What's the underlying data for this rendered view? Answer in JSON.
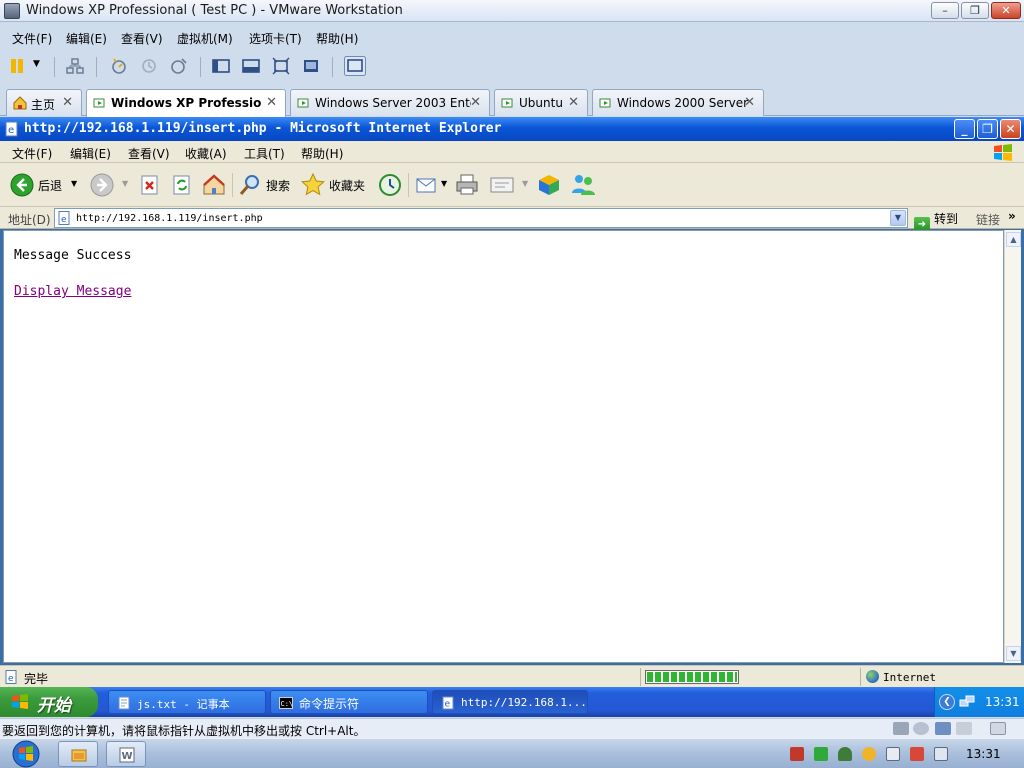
{
  "vmware": {
    "title": "Windows XP Professional ( Test PC ) - VMware Workstation",
    "window_buttons": [
      "–",
      "❐",
      "✕"
    ],
    "menu": [
      "文件(F)",
      "编辑(E)",
      "查看(V)",
      "虚拟机(M)",
      "选项卡(T)",
      "帮助(H)"
    ],
    "tabs": [
      {
        "label": "主页",
        "icon": "home-icon"
      },
      {
        "label": "Windows XP Professional...",
        "icon": "vm-icon",
        "active": true
      },
      {
        "label": "Windows Server 2003 Enterpr...",
        "icon": "vm-icon"
      },
      {
        "label": "Ubuntu",
        "icon": "vm-icon"
      },
      {
        "label": "Windows 2000 Server",
        "icon": "vm-icon"
      }
    ],
    "tab_close": "✕",
    "status_hint": "要返回到您的计算机，请将鼠标指针从虚拟机中移出或按 Ctrl+Alt。"
  },
  "ie": {
    "title": "http://192.168.1.119/insert.php - Microsoft Internet Explorer",
    "window_buttons": [
      "_",
      "❐",
      "✕"
    ],
    "menu": [
      "文件(F)",
      "编辑(E)",
      "查看(V)",
      "收藏(A)",
      "工具(T)",
      "帮助(H)"
    ],
    "toolbar": {
      "back": "后退",
      "search": "搜索",
      "favorites": "收藏夹"
    },
    "address": {
      "label": "地址(D)",
      "url": "http://192.168.1.119/insert.php",
      "go": "转到",
      "links": "链接",
      "more": "»"
    },
    "content": {
      "message": "Message Success",
      "link": "Display Message"
    },
    "status": {
      "text": "完毕",
      "zone": "Internet",
      "progress": 1.0
    }
  },
  "xp_taskbar": {
    "start": "开始",
    "tasks": [
      {
        "label": "js.txt - 记事本",
        "icon": "notepad-icon"
      },
      {
        "label": "命令提示符",
        "icon": "cmd-icon"
      },
      {
        "label": "http://192.168.1...",
        "icon": "ie-icon",
        "active": true
      }
    ],
    "clock": "13:31"
  },
  "host": {
    "clock": "13:31"
  },
  "colors": {
    "xp_blue": "#0a56d6",
    "xp_start_green": "#3b9b3c",
    "visited_link": "#800080"
  }
}
